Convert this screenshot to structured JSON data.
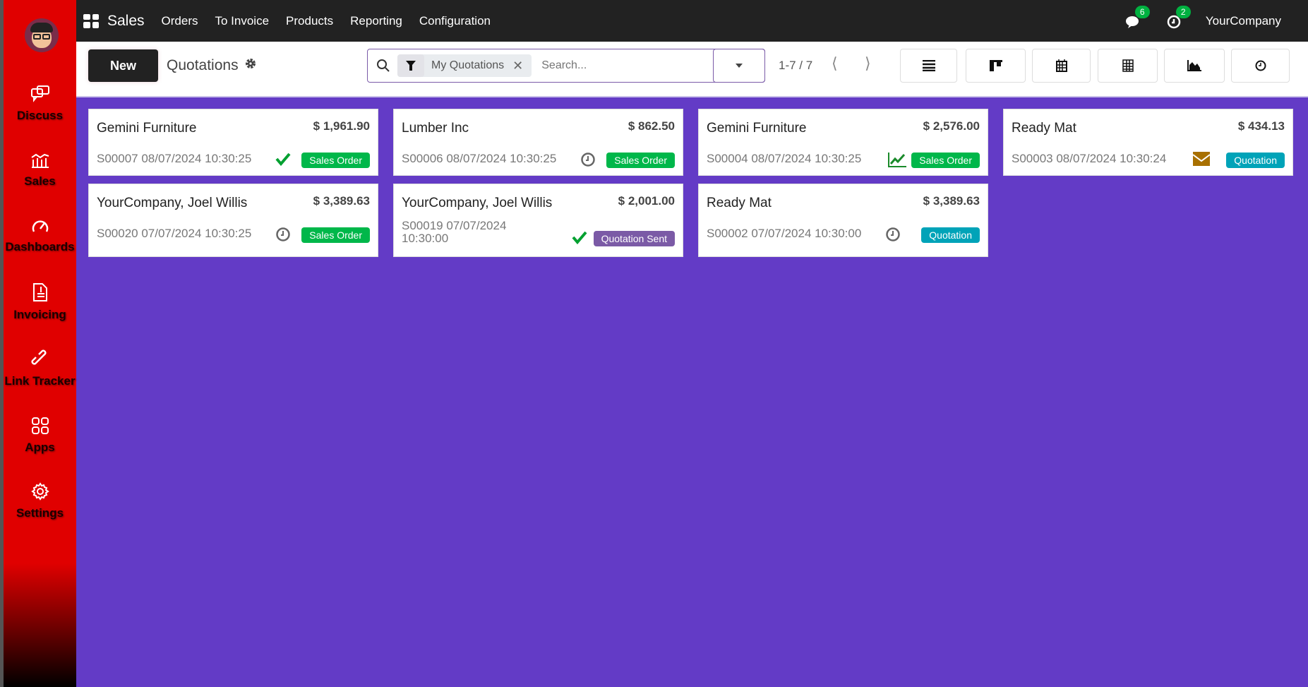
{
  "sidebar": {
    "items": [
      {
        "label": "Discuss",
        "icon": "chat-icon"
      },
      {
        "label": "Sales",
        "icon": "sales-chart-icon"
      },
      {
        "label": "Dashboards",
        "icon": "gauge-icon"
      },
      {
        "label": "Invoicing",
        "icon": "invoice-icon"
      },
      {
        "label": "Link Tracker",
        "icon": "link-icon"
      },
      {
        "label": "Apps",
        "icon": "apps-icon"
      },
      {
        "label": "Settings",
        "icon": "gear-icon"
      }
    ]
  },
  "topbar": {
    "app": "Sales",
    "menu": [
      "Orders",
      "To Invoice",
      "Products",
      "Reporting",
      "Configuration"
    ],
    "messages_count": "6",
    "activities_count": "2",
    "company": "YourCompany"
  },
  "control": {
    "new_label": "New",
    "title": "Quotations",
    "facet": "My Quotations",
    "search_placeholder": "Search...",
    "pager": "1-7 / 7"
  },
  "colors": {
    "sales_order": "#00b74a",
    "quotation": "#00a3b8",
    "quotation_sent": "#7b5aa6",
    "background": "#633bc6"
  },
  "cards": [
    {
      "name": "Gemini Furniture",
      "amount": "$ 1,961.90",
      "ref": "S00007 08/07/2024 10:30:25",
      "activity": "check",
      "status": "Sales Order",
      "kind": "sales_order"
    },
    {
      "name": "Lumber Inc",
      "amount": "$ 862.50",
      "ref": "S00006 08/07/2024 10:30:25",
      "activity": "clock",
      "status": "Sales Order",
      "kind": "sales_order"
    },
    {
      "name": "Gemini Furniture",
      "amount": "$ 2,576.00",
      "ref": "S00004 08/07/2024 10:30:25",
      "activity": "chart",
      "status": "Sales Order",
      "kind": "sales_order"
    },
    {
      "name": "Ready Mat",
      "amount": "$ 434.13",
      "ref": "S00003 08/07/2024 10:30:24",
      "activity": "envelope",
      "status": "Quotation",
      "kind": "quotation"
    },
    {
      "name": "YourCompany, Joel Willis",
      "amount": "$ 3,389.63",
      "ref": "S00020 07/07/2024 10:30:25",
      "activity": "clock",
      "status": "Sales Order",
      "kind": "sales_order"
    },
    {
      "name": "YourCompany, Joel Willis",
      "amount": "$ 2,001.00",
      "ref": "S00019 07/07/2024 10:30:00",
      "activity": "check",
      "status": "Quotation Sent",
      "kind": "quotation_sent"
    },
    {
      "name": "Ready Mat",
      "amount": "$ 3,389.63",
      "ref": "S00002 07/07/2024 10:30:00",
      "activity": "clock",
      "status": "Quotation",
      "kind": "quotation"
    }
  ]
}
